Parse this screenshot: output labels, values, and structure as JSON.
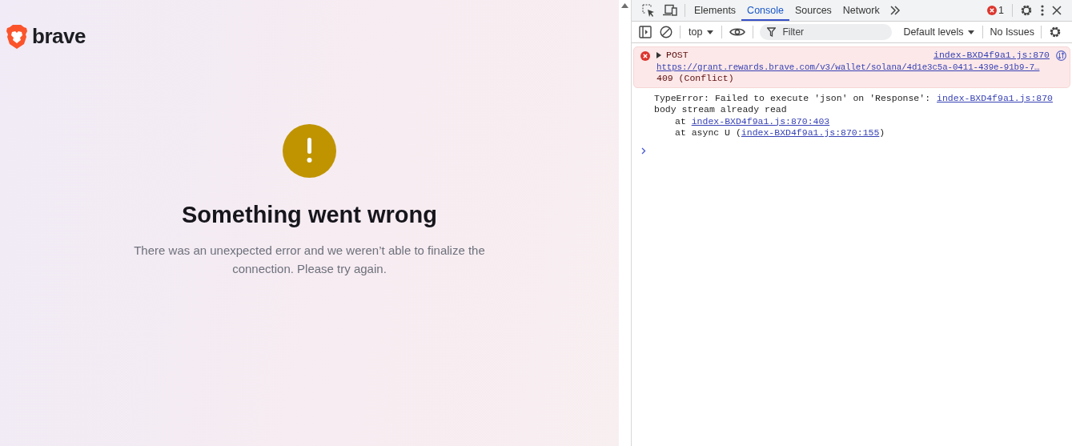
{
  "page": {
    "logo": "brave",
    "heading": "Something went wrong",
    "message": "There was an unexpected error and we weren’t able to finalize the connection. Please try again."
  },
  "devtools": {
    "tabs": [
      {
        "label": "Elements",
        "selected": false
      },
      {
        "label": "Console",
        "selected": true
      },
      {
        "label": "Sources",
        "selected": false
      },
      {
        "label": "Network",
        "selected": false
      }
    ],
    "error_count": "1",
    "toolbar": {
      "context": "top",
      "filter_placeholder": "Filter",
      "levels": "Default levels",
      "issues": "No Issues"
    },
    "messages": [
      {
        "kind": "error",
        "expanded": false,
        "method": "POST",
        "url": "https://grant.rewards.brave.com/v3/wallet/solana/4d1e3c5a-0411-439e-91b9-7…",
        "status": "409 (Conflict)",
        "source": "index-BXD4f9a1.js:870"
      },
      {
        "kind": "log",
        "text": "TypeError: Failed to execute 'json' on 'Response':",
        "text_2": "body stream already read",
        "source": "index-BXD4f9a1.js:870",
        "stack": [
          {
            "prefix": "at ",
            "link": "index-BXD4f9a1.js:870:403"
          },
          {
            "prefix": "at async U (",
            "link": "index-BXD4f9a1.js:870:155",
            "suffix": ")"
          }
        ]
      }
    ]
  }
}
